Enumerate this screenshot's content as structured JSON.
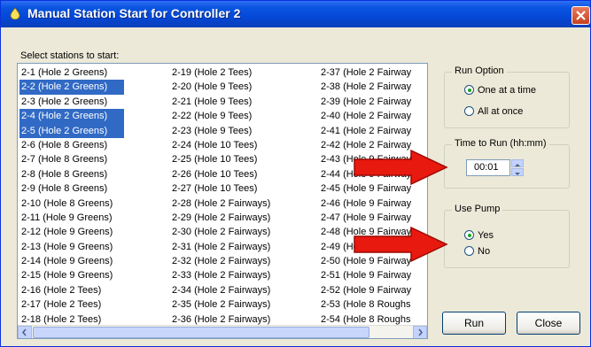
{
  "window": {
    "title": "Manual Station Start for Controller 2"
  },
  "list": {
    "label": "Select stations to start:",
    "columns": [
      [
        {
          "text": "2-1  (Hole 2 Greens)",
          "selected": false
        },
        {
          "text": "2-2  (Hole 2 Greens)",
          "selected": true
        },
        {
          "text": "2-3  (Hole 2 Greens)",
          "selected": false
        },
        {
          "text": "2-4  (Hole 2 Greens)",
          "selected": true
        },
        {
          "text": "2-5  (Hole 2 Greens)",
          "selected": true
        },
        {
          "text": "2-6  (Hole 8 Greens)",
          "selected": false
        },
        {
          "text": "2-7  (Hole 8 Greens)",
          "selected": false
        },
        {
          "text": "2-8  (Hole 8 Greens)",
          "selected": false
        },
        {
          "text": "2-9  (Hole 8 Greens)",
          "selected": false
        },
        {
          "text": "2-10  (Hole 8 Greens)",
          "selected": false
        },
        {
          "text": "2-11  (Hole 9 Greens)",
          "selected": false
        },
        {
          "text": "2-12  (Hole 9 Greens)",
          "selected": false
        },
        {
          "text": "2-13  (Hole 9 Greens)",
          "selected": false
        },
        {
          "text": "2-14  (Hole 9 Greens)",
          "selected": false
        },
        {
          "text": "2-15  (Hole 9 Greens)",
          "selected": false
        },
        {
          "text": "2-16  (Hole 2 Tees)",
          "selected": false
        },
        {
          "text": "2-17  (Hole 2 Tees)",
          "selected": false
        },
        {
          "text": "2-18  (Hole 2 Tees)",
          "selected": false
        }
      ],
      [
        {
          "text": "2-19  (Hole 2 Tees)",
          "selected": false
        },
        {
          "text": "2-20  (Hole 9 Tees)",
          "selected": false
        },
        {
          "text": "2-21  (Hole 9 Tees)",
          "selected": false
        },
        {
          "text": "2-22  (Hole 9 Tees)",
          "selected": false
        },
        {
          "text": "2-23  (Hole 9 Tees)",
          "selected": false
        },
        {
          "text": "2-24  (Hole 10 Tees)",
          "selected": false
        },
        {
          "text": "2-25  (Hole 10 Tees)",
          "selected": false
        },
        {
          "text": "2-26  (Hole 10 Tees)",
          "selected": false
        },
        {
          "text": "2-27  (Hole 10 Tees)",
          "selected": false
        },
        {
          "text": "2-28  (Hole 2 Fairways)",
          "selected": false
        },
        {
          "text": "2-29  (Hole 2 Fairways)",
          "selected": false
        },
        {
          "text": "2-30  (Hole 2 Fairways)",
          "selected": false
        },
        {
          "text": "2-31  (Hole 2 Fairways)",
          "selected": false
        },
        {
          "text": "2-32  (Hole 2 Fairways)",
          "selected": false
        },
        {
          "text": "2-33  (Hole 2 Fairways)",
          "selected": false
        },
        {
          "text": "2-34  (Hole 2 Fairways)",
          "selected": false
        },
        {
          "text": "2-35  (Hole 2 Fairways)",
          "selected": false
        },
        {
          "text": "2-36  (Hole 2 Fairways)",
          "selected": false
        }
      ],
      [
        {
          "text": "2-37  (Hole 2 Fairway",
          "selected": false
        },
        {
          "text": "2-38  (Hole 2 Fairway",
          "selected": false
        },
        {
          "text": "2-39  (Hole 2 Fairway",
          "selected": false
        },
        {
          "text": "2-40  (Hole 2 Fairway",
          "selected": false
        },
        {
          "text": "2-41  (Hole 2 Fairway",
          "selected": false
        },
        {
          "text": "2-42  (Hole 2 Fairway",
          "selected": false
        },
        {
          "text": "2-43  (Hole 9 Fairway",
          "selected": false
        },
        {
          "text": "2-44  (Hole 9 Fairway",
          "selected": false
        },
        {
          "text": "2-45  (Hole 9 Fairway",
          "selected": false
        },
        {
          "text": "2-46  (Hole 9 Fairway",
          "selected": false
        },
        {
          "text": "2-47  (Hole 9 Fairway",
          "selected": false
        },
        {
          "text": "2-48  (Hole 9 Fairway",
          "selected": false
        },
        {
          "text": "2-49  (Hole 9 Fairway",
          "selected": false
        },
        {
          "text": "2-50  (Hole 9 Fairway",
          "selected": false
        },
        {
          "text": "2-51  (Hole 9 Fairway",
          "selected": false
        },
        {
          "text": "2-52  (Hole 9 Fairway",
          "selected": false
        },
        {
          "text": "2-53  (Hole 8 Roughs",
          "selected": false
        },
        {
          "text": "2-54  (Hole 8 Roughs",
          "selected": false
        }
      ]
    ]
  },
  "run_option": {
    "title": "Run Option",
    "one_at_a_time": "One at a time",
    "all_at_once": "All at once",
    "selected": "one_at_a_time"
  },
  "time_to_run": {
    "title": "Time to Run (hh:mm)",
    "value": "00:01"
  },
  "use_pump": {
    "title": "Use Pump",
    "yes": "Yes",
    "no": "No",
    "selected": "yes"
  },
  "buttons": {
    "run": "Run",
    "close": "Close"
  },
  "colors": {
    "selection": "#316ac5",
    "title_bar": "#0a55e0",
    "annotation_arrow": "#e8190f"
  }
}
